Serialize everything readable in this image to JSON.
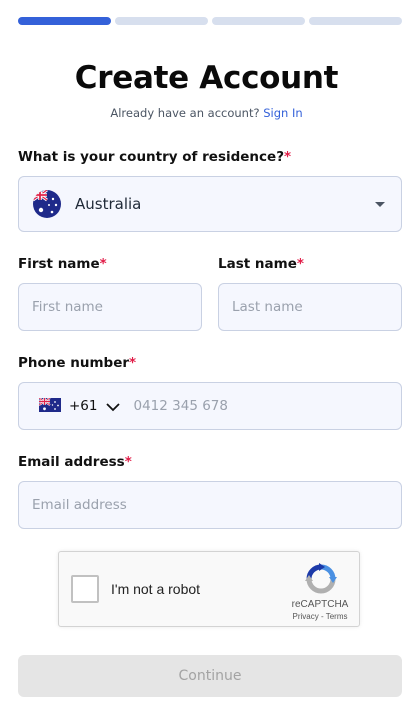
{
  "progress": {
    "total_steps": 4,
    "current_step": 1
  },
  "header": {
    "title": "Create Account",
    "subtitle": "Already have an account?",
    "signin_link": "Sign In"
  },
  "country": {
    "label": "What is your country of residence?",
    "required_mark": "*",
    "selected": "Australia",
    "flag_icon": "australia-flag-icon"
  },
  "first_name": {
    "label": "First name",
    "required_mark": "*",
    "placeholder": "First name"
  },
  "last_name": {
    "label": "Last name",
    "required_mark": "*",
    "placeholder": "Last name"
  },
  "phone": {
    "label": "Phone number",
    "required_mark": "*",
    "dial_code": "+61",
    "placeholder": "0412 345 678",
    "flag_icon": "australia-flag-icon"
  },
  "email": {
    "label": "Email address",
    "required_mark": "*",
    "placeholder": "Email address"
  },
  "captcha": {
    "text": "I'm not a robot",
    "brand": "reCAPTCHA",
    "terms": "Privacy - Terms"
  },
  "continue_button": {
    "label": "Continue",
    "disabled": true
  },
  "colors": {
    "accent": "#3461d9",
    "required": "#e11d48",
    "field_bg": "#f5f7fe",
    "field_border": "#c9d1e3",
    "progress_inactive": "#d7dfee",
    "disabled_button_bg": "#e5e5e5"
  }
}
